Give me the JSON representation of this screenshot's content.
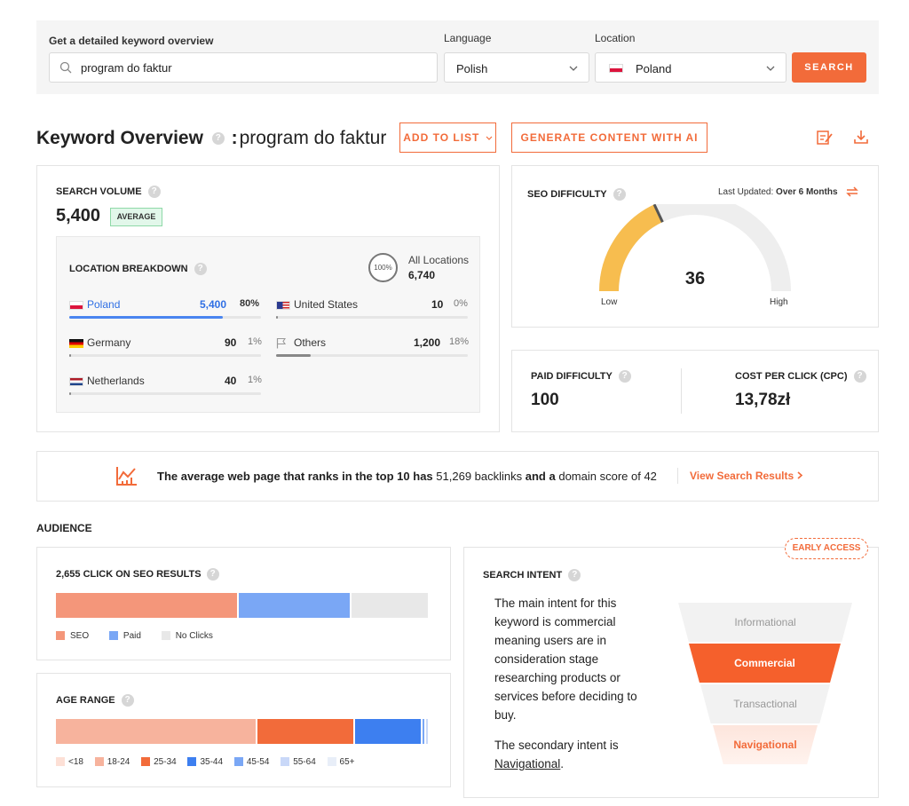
{
  "search_bar": {
    "keyword_label": "Get a detailed keyword overview",
    "keyword_value": "program do faktur",
    "language_label": "Language",
    "language_value": "Polish",
    "location_label": "Location",
    "location_value": "Poland",
    "search_button": "SEARCH"
  },
  "header": {
    "title": "Keyword Overview",
    "separator": ":",
    "keyword": "program do faktur",
    "add_to_list": "ADD TO LIST",
    "generate_ai": "GENERATE CONTENT WITH AI"
  },
  "search_volume": {
    "label": "SEARCH VOLUME",
    "value": "5,400",
    "badge": "AVERAGE",
    "breakdown_label": "LOCATION BREAKDOWN",
    "all_locations_percent": "100%",
    "all_locations_label": "All Locations",
    "all_locations_value": "6,740",
    "locations": [
      {
        "name": "Poland",
        "value": "5,400",
        "percent": "80%",
        "share": 0.8
      },
      {
        "name": "United States",
        "value": "10",
        "percent": "0%",
        "share": 0.0
      },
      {
        "name": "Germany",
        "value": "90",
        "percent": "1%",
        "share": 0.01
      },
      {
        "name": "Others",
        "value": "1,200",
        "percent": "18%",
        "share": 0.18
      },
      {
        "name": "Netherlands",
        "value": "40",
        "percent": "1%",
        "share": 0.01
      }
    ]
  },
  "seo_difficulty": {
    "label": "SEO DIFFICULTY",
    "updated_prefix": "Last Updated:",
    "updated_value": "Over 6 Months",
    "value": "36",
    "score": 36,
    "low": "Low",
    "high": "High"
  },
  "paid": {
    "paid_label": "PAID DIFFICULTY",
    "paid_value": "100",
    "cpc_label": "COST PER CLICK (CPC)",
    "cpc_value": "13,78zł"
  },
  "backlinks": {
    "text1": "The average web page that ranks in the top 10 has",
    "backlinks": "51,269 backlinks",
    "text2": "and a",
    "domain": "domain score of 42",
    "link": "View Search Results"
  },
  "audience": {
    "title": "AUDIENCE",
    "clicks_title": "2,655 CLICK ON SEO RESULTS",
    "clicks": [
      {
        "name": "SEO",
        "share": 0.49,
        "color": "#f4967a"
      },
      {
        "name": "Paid",
        "share": 0.3,
        "color": "#7aa7f5"
      },
      {
        "name": "No Clicks",
        "share": 0.21,
        "color": "#e8e8e8"
      }
    ],
    "age_title": "AGE RANGE",
    "ages": [
      {
        "name": "<18",
        "share": 0.0,
        "color": "#fde0d6"
      },
      {
        "name": "18-24",
        "share": 0.54,
        "color": "#f7b39d"
      },
      {
        "name": "25-34",
        "share": 0.26,
        "color": "#f26b3a"
      },
      {
        "name": "35-44",
        "share": 0.18,
        "color": "#3d7ff0"
      },
      {
        "name": "45-54",
        "share": 0.01,
        "color": "#7aa7f5"
      },
      {
        "name": "55-64",
        "share": 0.01,
        "color": "#c9d8f8"
      },
      {
        "name": "65+",
        "share": 0.0,
        "color": "#e8eef8"
      }
    ]
  },
  "intent": {
    "title": "SEARCH INTENT",
    "early_access": "EARLY ACCESS",
    "main_text": "The main intent for this keyword is commercial meaning users are in consideration stage researching products or services before deciding to buy.",
    "secondary_prefix": "The secondary intent is",
    "secondary_value": "Navigational",
    "secondary_suffix": ".",
    "funnel": [
      "Informational",
      "Commercial",
      "Transactional",
      "Navigational"
    ]
  }
}
